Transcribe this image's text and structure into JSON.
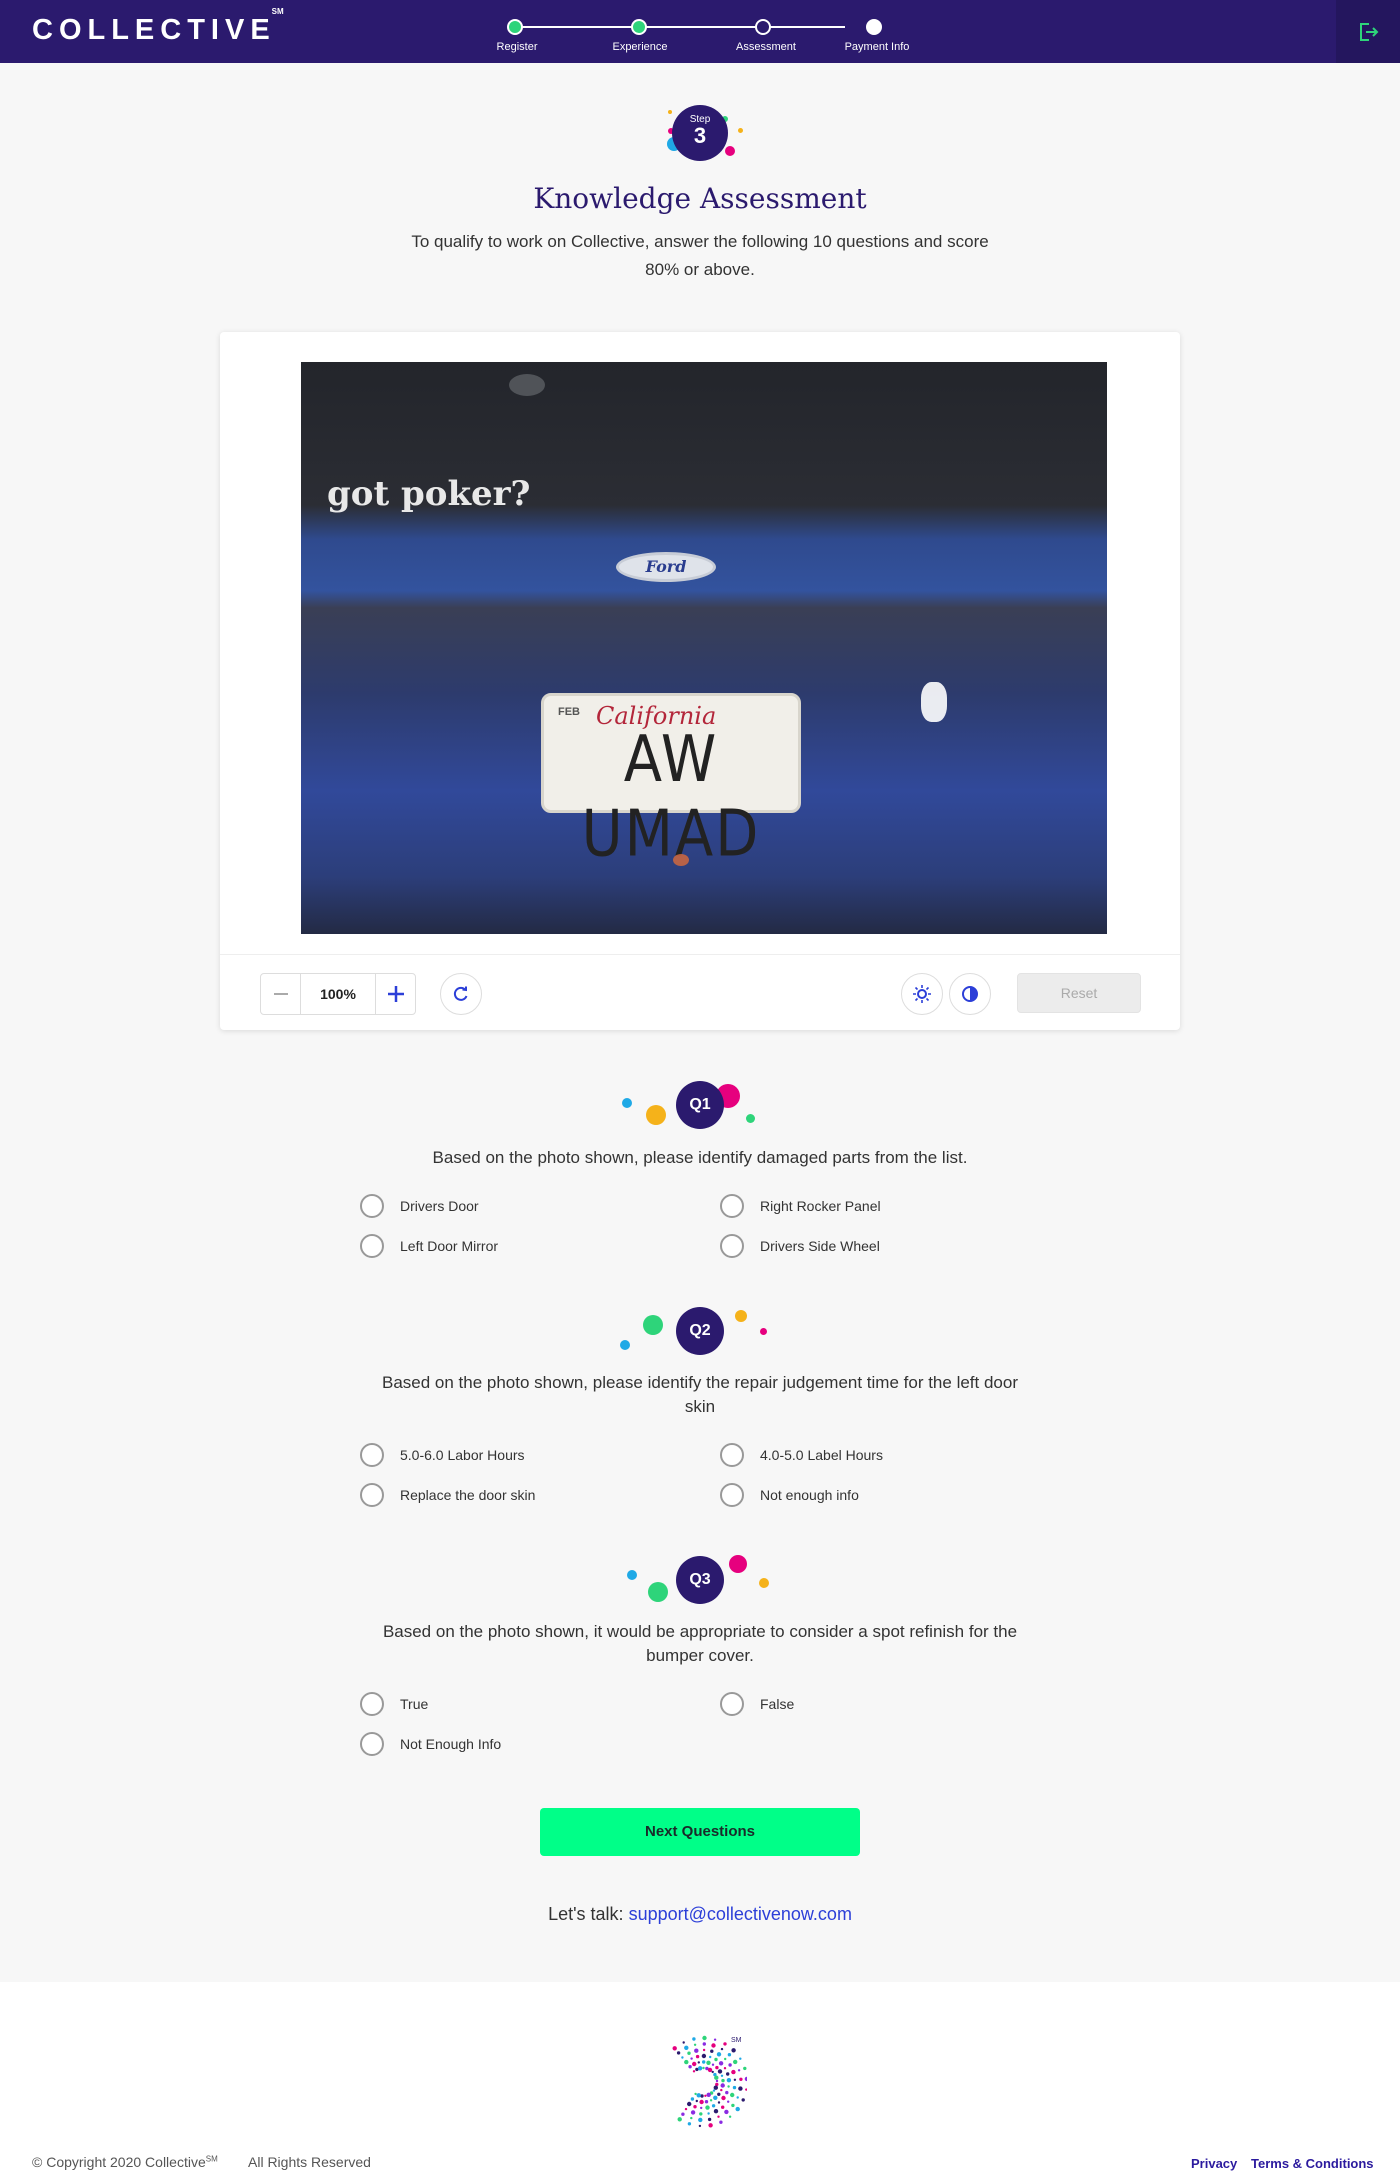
{
  "header": {
    "logo_text": "COLLECTIVE",
    "logo_mark": "SM",
    "steps": [
      {
        "label": "Register",
        "state": "done"
      },
      {
        "label": "Experience",
        "state": "done"
      },
      {
        "label": "Assessment",
        "state": "pending"
      },
      {
        "label": "Payment Info",
        "state": "current"
      }
    ],
    "logout_icon": "logout-icon"
  },
  "step_badge": {
    "label": "Step",
    "number": "3"
  },
  "title": "Knowledge Assessment",
  "subtitle": "To qualify to work on Collective, answer the following 10 questions and score 80% or above.",
  "image_viewer": {
    "photo_text": {
      "sticker": "got poker?",
      "emblem": "Ford",
      "plate_state": "California",
      "plate_month": "FEB",
      "plate_number": "AW UMAD"
    },
    "zoom_value": "100%",
    "rotate_icon": "rotate-icon",
    "brightness_icon": "brightness-icon",
    "contrast_icon": "contrast-icon",
    "reset_label": "Reset"
  },
  "questions": [
    {
      "badge": "Q1",
      "text": "Based on the photo shown, please identify damaged parts from the list.",
      "options": [
        "Drivers Door",
        "Right Rocker Panel",
        "Left Door Mirror",
        "Drivers Side Wheel"
      ]
    },
    {
      "badge": "Q2",
      "text": "Based on the photo shown, please identify the repair judgement time for the left door skin",
      "options": [
        "5.0-6.0 Labor Hours",
        "4.0-5.0 Label Hours",
        "Replace the door skin",
        "Not enough info"
      ]
    },
    {
      "badge": "Q3",
      "text": "Based on the photo shown, it would be appropriate to consider a spot refinish for the bumper cover.",
      "options": [
        "True",
        "False",
        "Not Enough Info"
      ]
    }
  ],
  "next_button": "Next Questions",
  "talk": {
    "prefix": "Let's talk:",
    "email": "support@collectivenow.com"
  },
  "footer": {
    "copyright": "© Copyright 2020 Collective",
    "copyright_mark": "SM",
    "rights": "All Rights Reserved",
    "privacy": "Privacy",
    "terms": "Terms & Conditions"
  },
  "colors": {
    "brand_purple": "#2b1a6e",
    "accent_green": "#00ff88",
    "step_done": "#2ed47a",
    "link_blue": "#2c3fd8"
  }
}
